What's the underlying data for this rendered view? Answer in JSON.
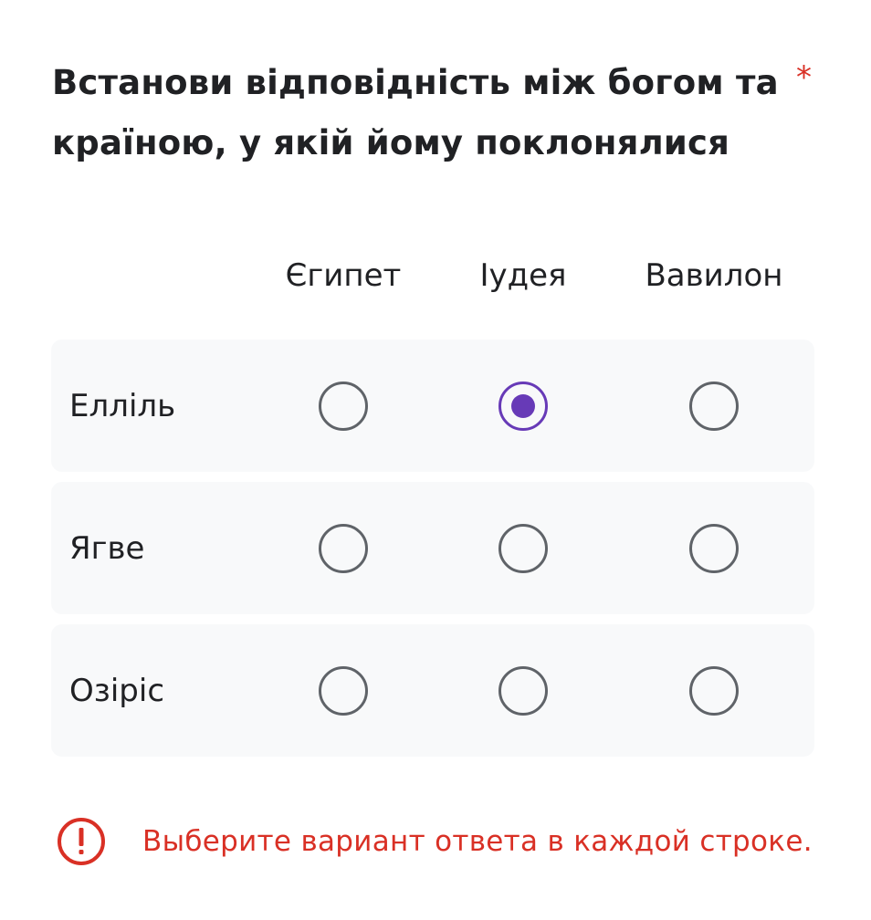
{
  "question": {
    "title": "Встанови відповідність між богом та країною, у якій йому поклонялися",
    "required_marker": "*"
  },
  "grid": {
    "columns": [
      "Єгипет",
      "Іудея",
      "Вавилон"
    ],
    "rows": [
      {
        "label": "Елліль",
        "selected": "Іудея"
      },
      {
        "label": "Ягве",
        "selected": null
      },
      {
        "label": "Озіріс",
        "selected": null
      }
    ]
  },
  "error": {
    "icon": "error-icon",
    "message": "Выберите вариант ответа в каждой строке."
  },
  "colors": {
    "accent": "#673ab7",
    "error": "#d93025",
    "row_background": "#f8f9fa",
    "radio_unselected": "#5f6368"
  }
}
